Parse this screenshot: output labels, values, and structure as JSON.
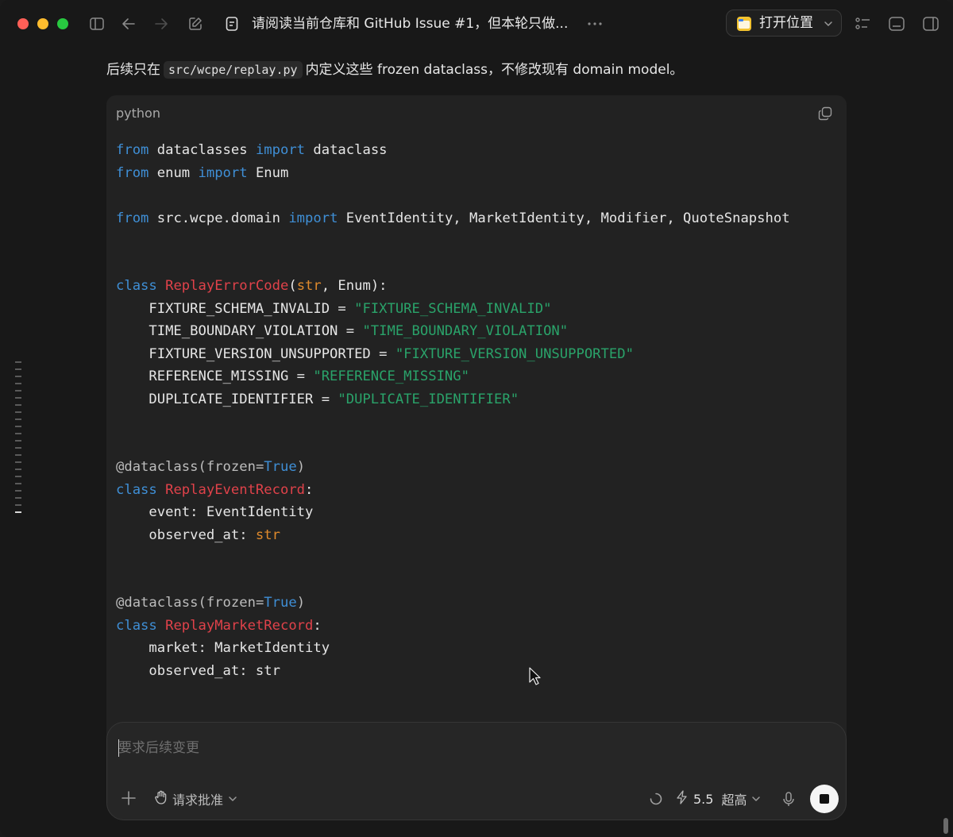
{
  "window": {
    "title": "请阅读当前仓库和 GitHub Issue #1，但本轮只做...",
    "open_location_label": "打开位置"
  },
  "message": {
    "intro_before": "后续只在",
    "intro_code": "src/wcpe/replay.py",
    "intro_after": "内定义这些 frozen dataclass，不修改现有 domain model。"
  },
  "code_block": {
    "language": "python",
    "lines": [
      "from dataclasses import dataclass",
      "from enum import Enum",
      "",
      "from src.wcpe.domain import EventIdentity, MarketIdentity, Modifier, QuoteSnapshot",
      "",
      "",
      "class ReplayErrorCode(str, Enum):",
      "    FIXTURE_SCHEMA_INVALID = \"FIXTURE_SCHEMA_INVALID\"",
      "    TIME_BOUNDARY_VIOLATION = \"TIME_BOUNDARY_VIOLATION\"",
      "    FIXTURE_VERSION_UNSUPPORTED = \"FIXTURE_VERSION_UNSUPPORTED\"",
      "    REFERENCE_MISSING = \"REFERENCE_MISSING\"",
      "    DUPLICATE_IDENTIFIER = \"DUPLICATE_IDENTIFIER\"",
      "",
      "",
      "@dataclass(frozen=True)",
      "class ReplayEventRecord:",
      "    event: EventIdentity",
      "    observed_at: str",
      "",
      "",
      "@dataclass(frozen=True)",
      "class ReplayMarketRecord:",
      "    market: MarketIdentity",
      "    observed_at: str"
    ]
  },
  "composer": {
    "placeholder": "要求后续变更",
    "approval_label": "请求批准",
    "model_version": "5.5",
    "reasoning_level": "超高"
  },
  "colors": {
    "keyword": "#3f8fd6",
    "class_name": "#e0424a",
    "string": "#2aa36a",
    "builtin": "#e08a2c"
  }
}
